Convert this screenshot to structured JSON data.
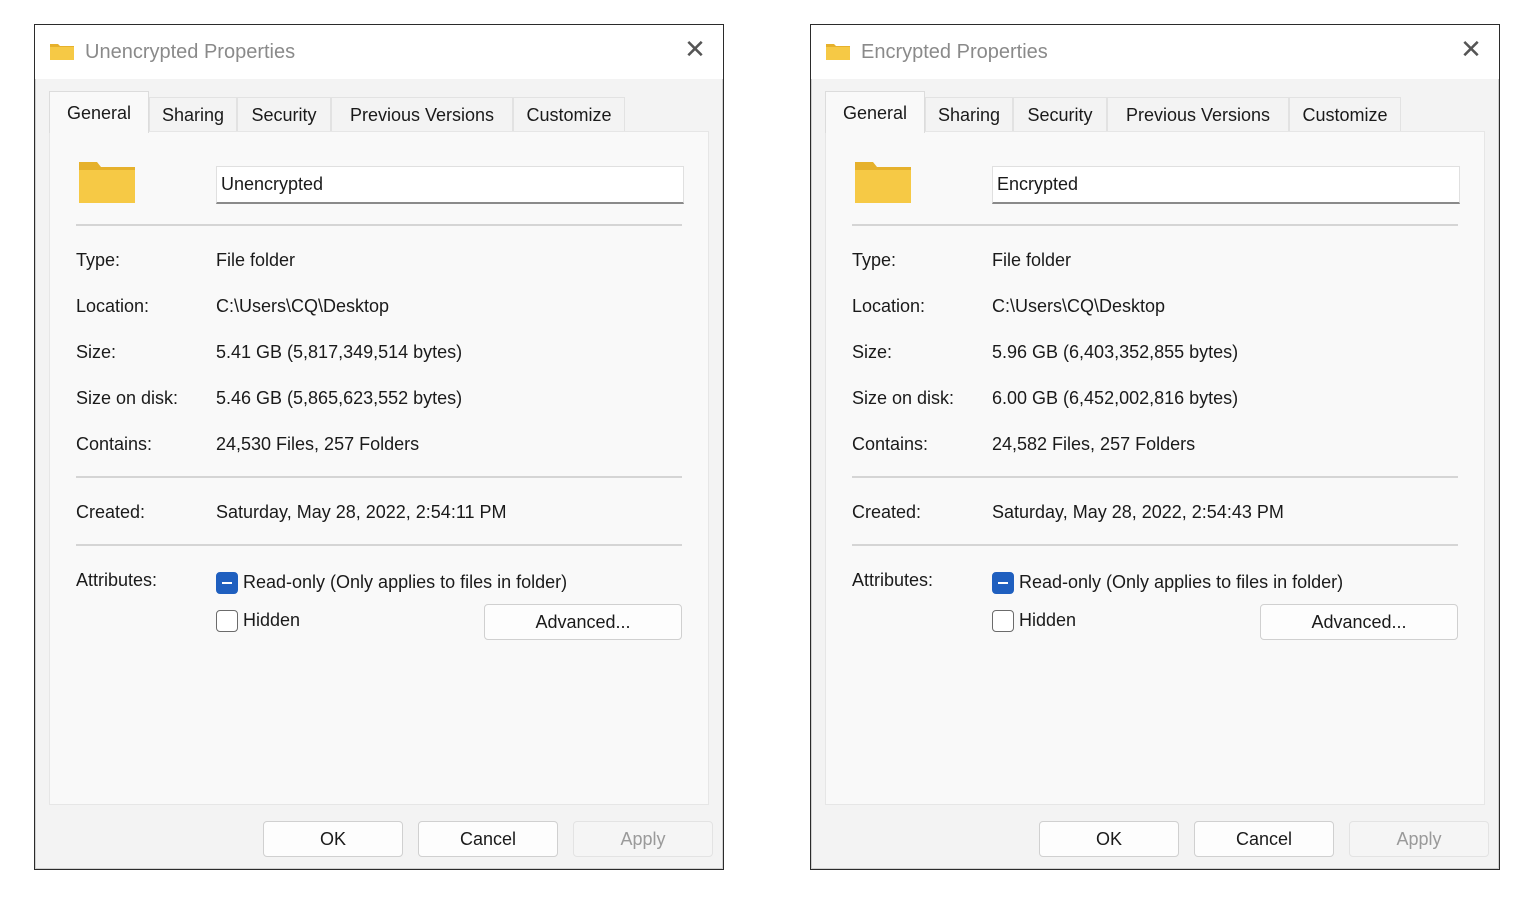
{
  "dialogs": [
    {
      "title": "Unencrypted Properties",
      "tabs": [
        "General",
        "Sharing",
        "Security",
        "Previous Versions",
        "Customize"
      ],
      "active_tab": "General",
      "name": "Unencrypted",
      "labels": {
        "type": "Type:",
        "location": "Location:",
        "size": "Size:",
        "size_on_disk": "Size on disk:",
        "contains": "Contains:",
        "created": "Created:",
        "attributes": "Attributes:"
      },
      "values": {
        "type": "File folder",
        "location": "C:\\Users\\CQ\\Desktop",
        "size": "5.41 GB (5,817,349,514 bytes)",
        "size_on_disk": "5.46 GB (5,865,623,552 bytes)",
        "contains": "24,530 Files, 257 Folders",
        "created": "Saturday, May 28, 2022, 2:54:11 PM"
      },
      "attributes": {
        "readonly_label": "Read-only (Only applies to files in folder)",
        "readonly_state": "indeterminate",
        "hidden_label": "Hidden",
        "hidden_state": "unchecked",
        "advanced_label": "Advanced..."
      },
      "buttons": {
        "ok": "OK",
        "cancel": "Cancel",
        "apply": "Apply"
      }
    },
    {
      "title": "Encrypted Properties",
      "tabs": [
        "General",
        "Sharing",
        "Security",
        "Previous Versions",
        "Customize"
      ],
      "active_tab": "General",
      "name": "Encrypted",
      "labels": {
        "type": "Type:",
        "location": "Location:",
        "size": "Size:",
        "size_on_disk": "Size on disk:",
        "contains": "Contains:",
        "created": "Created:",
        "attributes": "Attributes:"
      },
      "values": {
        "type": "File folder",
        "location": "C:\\Users\\CQ\\Desktop",
        "size": "5.96 GB (6,403,352,855 bytes)",
        "size_on_disk": "6.00 GB (6,452,002,816 bytes)",
        "contains": "24,582 Files, 257 Folders",
        "created": "Saturday, May 28, 2022, 2:54:43 PM"
      },
      "attributes": {
        "readonly_label": "Read-only (Only applies to files in folder)",
        "readonly_state": "indeterminate",
        "hidden_label": "Hidden",
        "hidden_state": "unchecked",
        "advanced_label": "Advanced..."
      },
      "buttons": {
        "ok": "OK",
        "cancel": "Cancel",
        "apply": "Apply"
      }
    }
  ],
  "icons": {
    "title_icon": "folder-icon",
    "big_icon": "folder-icon",
    "close": "close-icon"
  },
  "colors": {
    "folder_yellow": "#f6c945",
    "folder_dark": "#e6b12c",
    "checkbox_blue": "#1f5fbf",
    "title_gray": "#8a8a8a"
  }
}
